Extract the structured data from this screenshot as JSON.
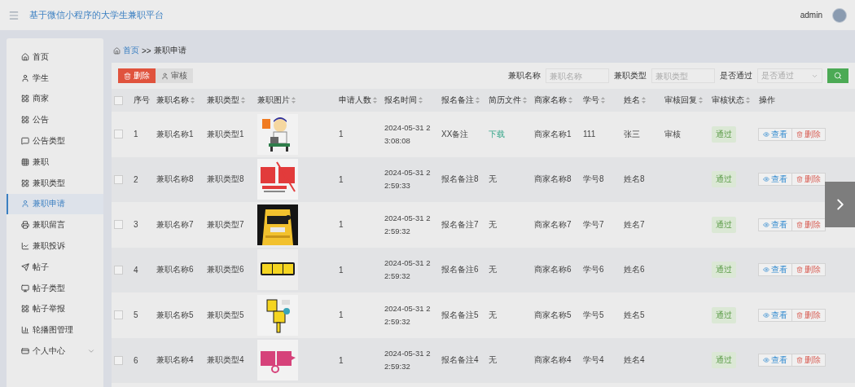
{
  "header": {
    "title": "基于微信小程序的大学生兼职平台",
    "user": "admin"
  },
  "sidebar": {
    "items": [
      {
        "label": "首页",
        "selected": false
      },
      {
        "label": "学生",
        "selected": false
      },
      {
        "label": "商家",
        "selected": false
      },
      {
        "label": "公告",
        "selected": false
      },
      {
        "label": "公告类型",
        "selected": false
      },
      {
        "label": "兼职",
        "selected": false
      },
      {
        "label": "兼职类型",
        "selected": false
      },
      {
        "label": "兼职申请",
        "selected": true
      },
      {
        "label": "兼职留言",
        "selected": false
      },
      {
        "label": "兼职投诉",
        "selected": false
      },
      {
        "label": "帖子",
        "selected": false
      },
      {
        "label": "帖子类型",
        "selected": false
      },
      {
        "label": "帖子举报",
        "selected": false
      },
      {
        "label": "轮播图管理",
        "selected": false
      },
      {
        "label": "个人中心",
        "selected": false,
        "expanded": false
      }
    ]
  },
  "breadcrumb": {
    "home": "首页",
    "separator": ">>",
    "current": "兼职申请"
  },
  "toolbar": {
    "buttons": [
      {
        "kind": "danger",
        "label": "删除"
      },
      {
        "kind": "default",
        "label": "审核"
      }
    ],
    "filters": [
      {
        "kind": "input",
        "label": "兼职名称",
        "placeholder": "兼职名称"
      },
      {
        "kind": "input",
        "label": "兼职类型",
        "placeholder": "兼职类型"
      },
      {
        "kind": "select",
        "label": "是否通过",
        "placeholder": "是否通过"
      }
    ]
  },
  "table": {
    "all_checked": false,
    "columns": [
      {
        "label": "序号",
        "sortable": false
      },
      {
        "label": "兼职名称",
        "sortable": true
      },
      {
        "label": "兼职类型",
        "sortable": true
      },
      {
        "label": "兼职图片",
        "sortable": true
      },
      {
        "label": "申请人数",
        "sortable": true
      },
      {
        "label": "报名时间",
        "sortable": true
      },
      {
        "label": "报名备注",
        "sortable": true
      },
      {
        "label": "简历文件",
        "sortable": true
      },
      {
        "label": "商家名称",
        "sortable": true
      },
      {
        "label": "学号",
        "sortable": true
      },
      {
        "label": "姓名",
        "sortable": true
      },
      {
        "label": "审核回复",
        "sortable": true
      },
      {
        "label": "审核状态",
        "sortable": true
      },
      {
        "label": "操作",
        "sortable": false
      }
    ],
    "rows": [
      {
        "checked": false,
        "index": "1",
        "name": "兼职名称1",
        "type": "兼职类型1",
        "picture": {
          "kind": "picture"
        },
        "applicants": "1",
        "time": "2024-05-31 23:08:08",
        "note": "XX备注",
        "resume": {
          "kind": "link",
          "text": "下载"
        },
        "merchant": "商家名称1",
        "student_no": "111",
        "student_name": "张三",
        "reply": "审核",
        "status": "通过",
        "actions": [
          {
            "kind": "view",
            "label": "查看"
          },
          {
            "kind": "delete",
            "label": "删除"
          }
        ]
      },
      {
        "checked": false,
        "index": "2",
        "name": "兼职名称8",
        "type": "兼职类型8",
        "picture": {
          "kind": "picture"
        },
        "applicants": "1",
        "time": "2024-05-31 22:59:33",
        "note": "报名备注8",
        "resume": {
          "kind": "text",
          "text": "无"
        },
        "merchant": "商家名称8",
        "student_no": "学号8",
        "student_name": "姓名8",
        "status": "通过",
        "actions": [
          {
            "kind": "view",
            "label": "查看"
          },
          {
            "kind": "delete",
            "label": "删除"
          }
        ]
      },
      {
        "checked": false,
        "index": "3",
        "name": "兼职名称7",
        "type": "兼职类型7",
        "picture": {
          "kind": "picture"
        },
        "applicants": "1",
        "time": "2024-05-31 22:59:32",
        "note": "报名备注7",
        "resume": {
          "kind": "text",
          "text": "无"
        },
        "merchant": "商家名称7",
        "student_no": "学号7",
        "student_name": "姓名7",
        "status": "通过",
        "actions": [
          {
            "kind": "view",
            "label": "查看"
          },
          {
            "kind": "delete",
            "label": "删除"
          }
        ]
      },
      {
        "checked": false,
        "index": "4",
        "name": "兼职名称6",
        "type": "兼职类型6",
        "picture": {
          "kind": "picture"
        },
        "applicants": "1",
        "time": "2024-05-31 22:59:32",
        "note": "报名备注6",
        "resume": {
          "kind": "text",
          "text": "无"
        },
        "merchant": "商家名称6",
        "student_no": "学号6",
        "student_name": "姓名6",
        "status": "通过",
        "actions": [
          {
            "kind": "view",
            "label": "查看"
          },
          {
            "kind": "delete",
            "label": "删除"
          }
        ]
      },
      {
        "checked": false,
        "index": "5",
        "name": "兼职名称5",
        "type": "兼职类型5",
        "picture": {
          "kind": "picture"
        },
        "applicants": "1",
        "time": "2024-05-31 22:59:32",
        "note": "报名备注5",
        "resume": {
          "kind": "text",
          "text": "无"
        },
        "merchant": "商家名称5",
        "student_no": "学号5",
        "student_name": "姓名5",
        "status": "通过",
        "actions": [
          {
            "kind": "view",
            "label": "查看"
          },
          {
            "kind": "delete",
            "label": "删除"
          }
        ]
      },
      {
        "checked": false,
        "index": "6",
        "name": "兼职名称4",
        "type": "兼职类型4",
        "picture": {
          "kind": "picture"
        },
        "applicants": "1",
        "time": "2024-05-31 22:59:32",
        "note": "报名备注4",
        "resume": {
          "kind": "text",
          "text": "无"
        },
        "merchant": "商家名称4",
        "student_no": "学号4",
        "student_name": "姓名4",
        "status": "通过",
        "actions": [
          {
            "kind": "view",
            "label": "查看"
          },
          {
            "kind": "delete",
            "label": "删除"
          }
        ]
      }
    ]
  }
}
